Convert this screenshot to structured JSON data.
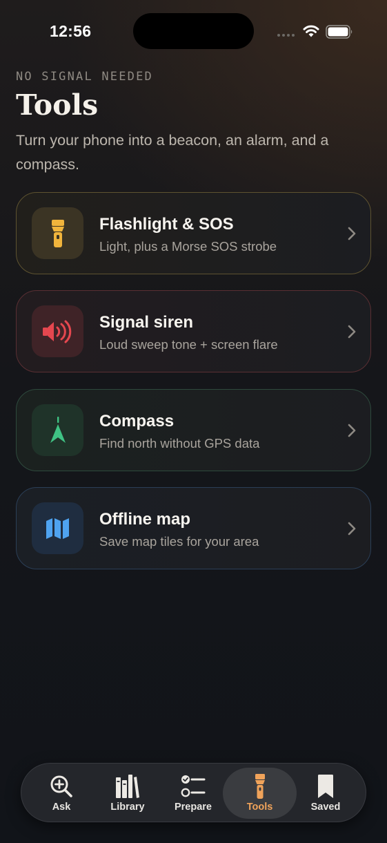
{
  "status_bar": {
    "time": "12:56"
  },
  "header": {
    "eyebrow": "NO SIGNAL NEEDED",
    "title": "Tools",
    "subtitle": "Turn your phone into a beacon, an alarm, and a compass."
  },
  "tools": [
    {
      "title": "Flashlight & SOS",
      "description": "Light, plus a Morse SOS strobe",
      "icon": "flashlight-icon",
      "accent": "#f0b43c"
    },
    {
      "title": "Signal siren",
      "description": "Loud sweep tone + screen flare",
      "icon": "speaker-icon",
      "accent": "#e5474f"
    },
    {
      "title": "Compass",
      "description": "Find north without GPS data",
      "icon": "compass-arrow-icon",
      "accent": "#3fc384"
    },
    {
      "title": "Offline map",
      "description": "Save map tiles for your area",
      "icon": "map-icon",
      "accent": "#4fa3f0"
    }
  ],
  "tab_bar": {
    "tabs": [
      {
        "label": "Ask",
        "icon": "search-plus-icon",
        "active": false
      },
      {
        "label": "Library",
        "icon": "books-icon",
        "active": false
      },
      {
        "label": "Prepare",
        "icon": "checklist-icon",
        "active": false
      },
      {
        "label": "Tools",
        "icon": "flashlight-icon",
        "active": true
      },
      {
        "label": "Saved",
        "icon": "bookmark-icon",
        "active": false
      }
    ],
    "active_color": "#f0a35a"
  }
}
